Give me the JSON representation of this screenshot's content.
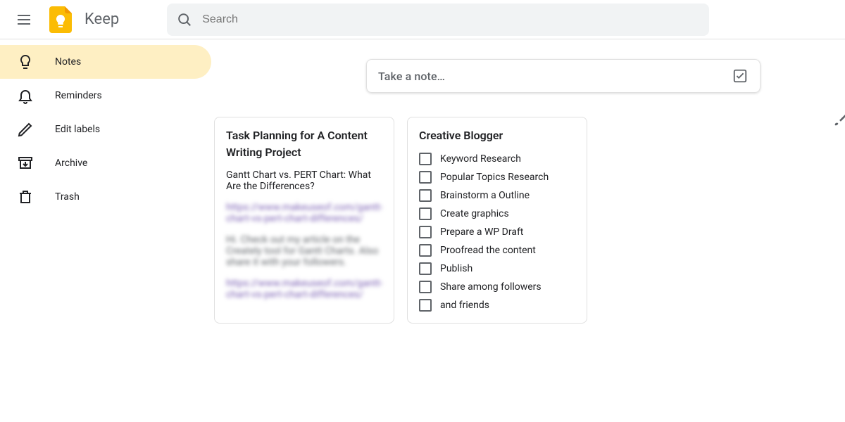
{
  "header": {
    "app_name": "Keep",
    "search_placeholder": "Search"
  },
  "sidebar": {
    "items": [
      {
        "label": "Notes",
        "icon": "lightbulb",
        "active": true
      },
      {
        "label": "Reminders",
        "icon": "bell",
        "active": false
      },
      {
        "label": "Edit labels",
        "icon": "pencil",
        "active": false
      },
      {
        "label": "Archive",
        "icon": "archive",
        "active": false
      },
      {
        "label": "Trash",
        "icon": "trash",
        "active": false
      }
    ]
  },
  "compose": {
    "placeholder": "Take a note…"
  },
  "notes": [
    {
      "title": "Task Planning for A Content Writing Project",
      "body": "Gantt Chart vs. PERT Chart: What Are the Differences?",
      "blurred_link_1": "https://www.makeuseof.com/gantt-chart-vs-pert-chart-differences/",
      "blurred_text": "Hi. Check out my article on the Creately tool for Gantt Charts. Also share it with your followers.",
      "blurred_link_2": "https://www.makeuseof.com/gantt-chart-vs-pert-chart-differences/"
    },
    {
      "title": "Creative Blogger",
      "checklist": [
        "Keyword Research",
        "Popular Topics Research",
        "Brainstorm a Outline",
        "Create graphics",
        "Prepare a WP Draft",
        "Proofread the content",
        "Publish",
        "Share among followers",
        " and friends"
      ]
    }
  ]
}
